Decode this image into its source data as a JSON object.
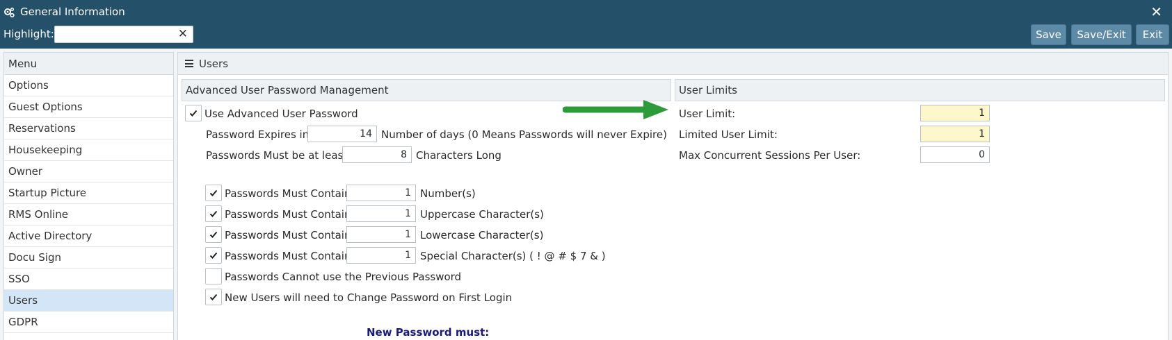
{
  "window": {
    "title": "General Information",
    "close_label": "✕"
  },
  "highlight": {
    "label": "Highlight:",
    "value": "",
    "clear_label": "✕"
  },
  "toolbar": {
    "save_label": "Save",
    "save_exit_label": "Save/Exit",
    "exit_label": "Exit"
  },
  "menu": {
    "header": "Menu",
    "items": [
      {
        "label": "Options"
      },
      {
        "label": "Guest Options"
      },
      {
        "label": "Reservations"
      },
      {
        "label": "Housekeeping"
      },
      {
        "label": "Owner"
      },
      {
        "label": "Startup Picture"
      },
      {
        "label": "RMS Online"
      },
      {
        "label": "Active Directory"
      },
      {
        "label": "Docu Sign"
      },
      {
        "label": "SSO"
      },
      {
        "label": "Users"
      },
      {
        "label": "GDPR"
      }
    ],
    "active_index": 10
  },
  "main": {
    "title": "Users",
    "password_section": {
      "header": "Advanced User Password Management",
      "use_advanced": {
        "label": "Use Advanced User Password",
        "checked": true
      },
      "expires": {
        "label": "Password Expires in",
        "value": "14",
        "suffix": "Number of days (0 Means Passwords will never Expire)"
      },
      "min_length": {
        "label": "Passwords Must be at least",
        "value": "8",
        "suffix": "Characters Long"
      },
      "rules": [
        {
          "label": "Passwords Must Contain",
          "value": "1",
          "suffix": "Number(s)",
          "checked": true
        },
        {
          "label": "Passwords Must Contain",
          "value": "1",
          "suffix": "Uppercase Character(s)",
          "checked": true
        },
        {
          "label": "Passwords Must Contain",
          "value": "1",
          "suffix": "Lowercase Character(s)",
          "checked": true
        },
        {
          "label": "Passwords Must Contain",
          "value": "1",
          "suffix": "Special Character(s) ( ! @ # $ 7 & )",
          "checked": true
        }
      ],
      "no_previous": {
        "label": "Passwords Cannot use the Previous Password",
        "checked": false
      },
      "change_first_login": {
        "label": "New Users will need to Change Password on First Login",
        "checked": true
      },
      "new_password_heading": "New Password must:"
    },
    "limits_section": {
      "header": "User Limits",
      "user_limit": {
        "label": "User Limit:",
        "value": "1"
      },
      "limited_user_limit": {
        "label": "Limited User Limit:",
        "value": "1"
      },
      "max_sessions": {
        "label": "Max Concurrent Sessions Per User:",
        "value": "0"
      }
    }
  },
  "colors": {
    "titlebar": "#24506a",
    "button": "#5d8aa6",
    "active_menu": "#d2e6f7",
    "highlight_field": "#fdf7cc",
    "arrow": "#2e9b3a",
    "heading_blue": "#1a1a7a"
  }
}
